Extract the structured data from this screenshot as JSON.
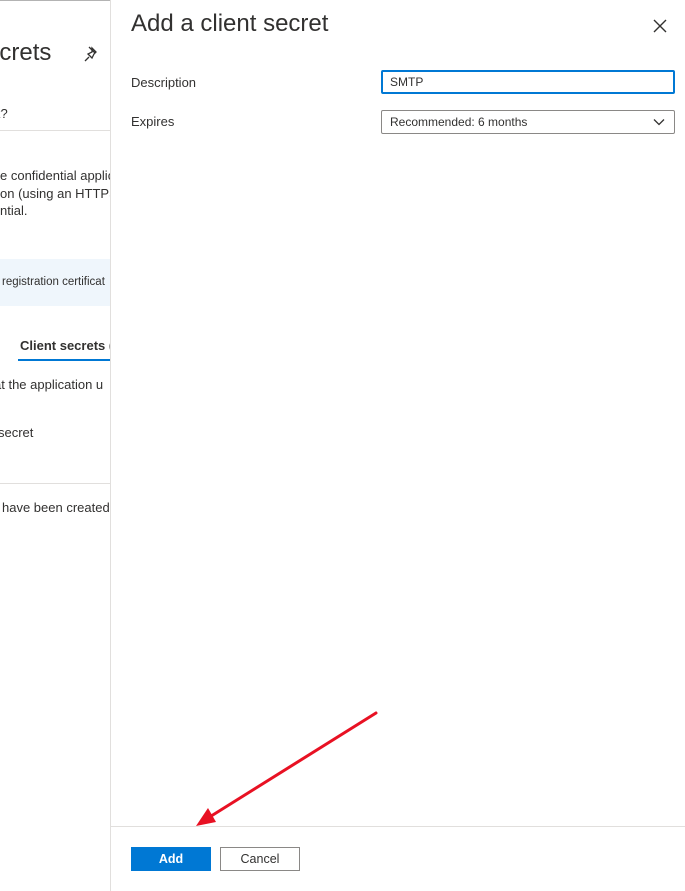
{
  "background": {
    "title_fragment": "ecrets",
    "ask_fragment": "k?",
    "paragraph_lines": [
      "e confidential applic",
      "on (using an HTTPS",
      "ntial."
    ],
    "banner_text": "registration certificat",
    "tab_label": "Client secrets (",
    "tab_desc": "at the application u",
    "new_secret": "secret",
    "empty_text": "have been created"
  },
  "panel": {
    "title": "Add a client secret",
    "description_label": "Description",
    "description_value": "SMTP",
    "expires_label": "Expires",
    "expires_value": "Recommended: 6 months",
    "add_label": "Add",
    "cancel_label": "Cancel"
  },
  "colors": {
    "accent": "#0078d4",
    "annotation_arrow": "#e81123"
  }
}
